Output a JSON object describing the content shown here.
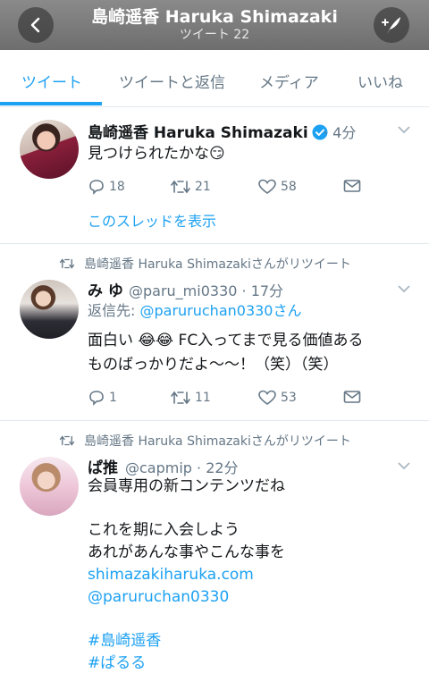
{
  "header": {
    "title": "島崎遥香 Haruka Shimazaki",
    "subtitle": "ツイート 22"
  },
  "tabs": [
    {
      "label": "ツイート",
      "active": true
    },
    {
      "label": "ツイートと返信",
      "active": false
    },
    {
      "label": "メディア",
      "active": false
    },
    {
      "label": "いいね",
      "active": false
    }
  ],
  "tweets": [
    {
      "name": "島崎遥香 Haruka Shimazaki",
      "verified": true,
      "time": "· 4分",
      "lines": [
        "見つけられたかな😏"
      ],
      "replies": "18",
      "retweets": "21",
      "likes": "58",
      "thread_link": "このスレッドを表示"
    },
    {
      "retweeted_by": "島崎遥香 Haruka Shimazakiさんがリツイート",
      "name": "み ゆ",
      "handle": "@paru_mi0330 · 17分",
      "reply_to_prefix": "返信先: ",
      "reply_to_user": "@paruruchan0330さん",
      "lines": [
        "面白い 😂😂 FC入ってまで見る価値ある",
        "ものばっかりだよ〜〜！（笑）（笑）"
      ],
      "replies": "1",
      "retweets": "11",
      "likes": "53"
    },
    {
      "retweeted_by": "島崎遥香 Haruka Shimazakiさんがリツイート",
      "name": "ぱ推",
      "handle": "@capmip · 22分",
      "lines": [
        "会員専用の新コンテンツだね",
        "",
        "これを期に入会しよう",
        "あれがあんな事やこんな事を"
      ],
      "link_url": "shimazakiharuka.com",
      "link_mention": "@paruruchan0330",
      "hashtags": [
        "#島崎遥香",
        "#ぱるる"
      ]
    }
  ],
  "colors": {
    "accent": "#1da1f2",
    "muted": "#657786",
    "text": "#14171a",
    "verified": "#1da1f2"
  }
}
